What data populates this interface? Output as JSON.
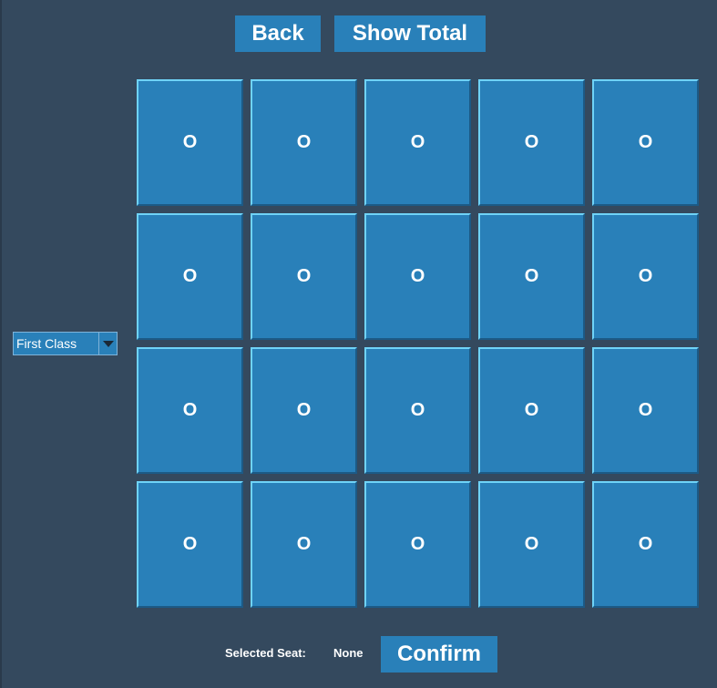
{
  "toolbar": {
    "back_label": "Back",
    "show_total_label": "Show Total"
  },
  "class_select": {
    "selected": "First Class",
    "arrow_icon": "triangle-down-icon"
  },
  "seats": {
    "rows": [
      [
        "O",
        "O",
        "O",
        "O",
        "O"
      ],
      [
        "O",
        "O",
        "O",
        "O",
        "O"
      ],
      [
        "O",
        "O",
        "O",
        "O",
        "O"
      ],
      [
        "O",
        "O",
        "O",
        "O",
        "O"
      ]
    ]
  },
  "footer": {
    "selected_seat_label": "Selected Seat:",
    "selected_seat_value": "None",
    "confirm_label": "Confirm"
  },
  "colors": {
    "background": "#34495e",
    "button": "#2980b9",
    "seat_highlight": "#6fd3f7",
    "text": "#ffffff"
  }
}
